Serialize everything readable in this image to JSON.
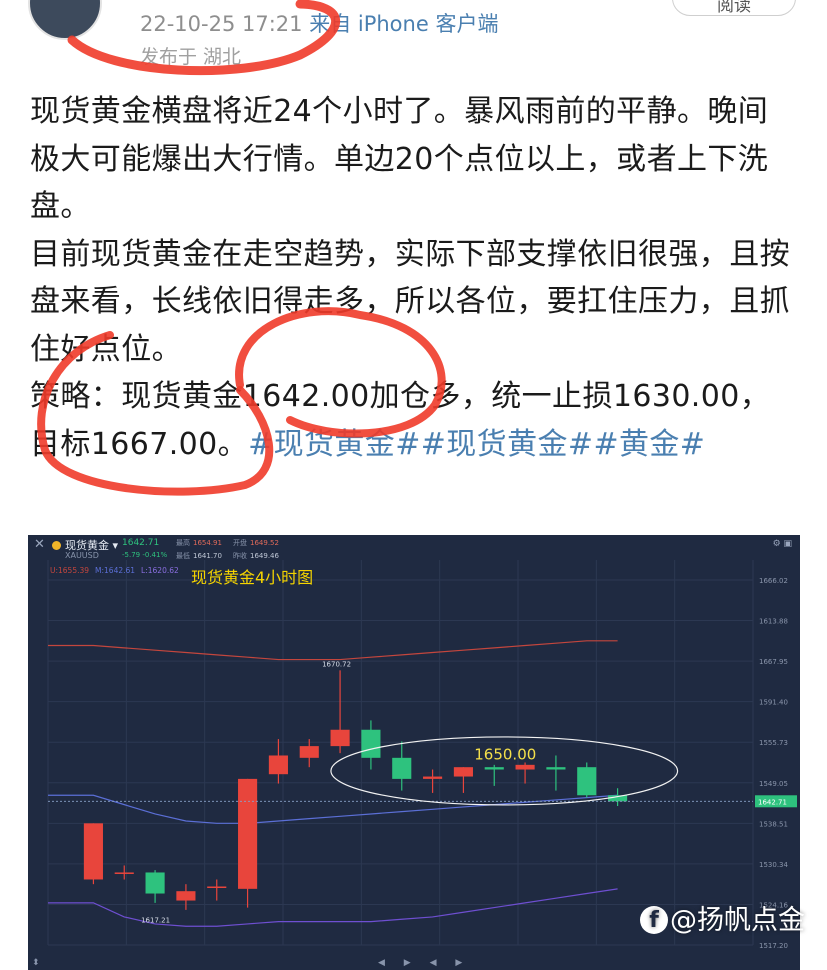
{
  "header": {
    "time": "22-10-25 17:21",
    "source": "来自 iPhone 客户端",
    "location": "发布于 湖北",
    "follow_label": "阅读"
  },
  "post": {
    "line1": "现货黄金横盘将近24个小时了。暴风雨前的平静。晚间极大可能爆出大行情。单边20个点位以上，或者上下洗盘。",
    "line2": "目前现货黄金在走空趋势，实际下部支撑依旧很强，且按盘来看，长线依旧得走多，所以各位，要扛住压力，且抓住好点位。",
    "line3_text": "策略：现货黄金1642.00加仓多，统一止损1630.00，目标1667.00。",
    "tags": [
      "#现货黄金#",
      "#现货黄金#",
      "#黄金#"
    ]
  },
  "chart_header": {
    "close": "✕",
    "name": "现货黄金 ▾",
    "symbol": "XAUUSD",
    "last": "1642.71",
    "change": "-5.79  -0.41%",
    "stats": [
      {
        "k": "最高",
        "v": "1654.91"
      },
      {
        "k": "开盘",
        "v": "1649.52"
      },
      {
        "k": "最低",
        "v": "1641.70"
      },
      {
        "k": "昨收",
        "v": "1649.46"
      }
    ],
    "bb": {
      "upper": "U:1655.39",
      "mid": "M:1642.61",
      "lower": "L:1620.62"
    },
    "title": "现货黄金4小时图",
    "footer": "◀ ▶ ◀ ▶"
  },
  "chart_data": {
    "type": "candlestick",
    "title": "现货黄金4小时图",
    "ylim": [
      1612,
      1690
    ],
    "y_ticks": [
      "1666.02",
      "1613.88",
      "1667.95",
      "1591.40",
      "1555.73",
      "1549.05",
      "1538.51",
      "1530.34",
      "1524.16",
      "1517.20"
    ],
    "last_price_label": "1642.71",
    "high_label": "1670.72",
    "low_label": "1617.21",
    "annotation": "1650.00",
    "candles": [
      {
        "o": 1626.0,
        "h": 1638.0,
        "l": 1625.0,
        "c": 1638.0
      },
      {
        "o": 1627.5,
        "h": 1629.0,
        "l": 1626.0,
        "c": 1627.5
      },
      {
        "o": 1627.5,
        "h": 1628.0,
        "l": 1621.0,
        "c": 1623.0
      },
      {
        "o": 1621.5,
        "h": 1625.0,
        "l": 1619.5,
        "c": 1623.5
      },
      {
        "o": 1624.5,
        "h": 1626.0,
        "l": 1621.5,
        "c": 1624.5
      },
      {
        "o": 1624.0,
        "h": 1647.5,
        "l": 1620.0,
        "c": 1647.5
      },
      {
        "o": 1648.5,
        "h": 1656.0,
        "l": 1646.5,
        "c": 1652.5
      },
      {
        "o": 1652.0,
        "h": 1656.0,
        "l": 1650.0,
        "c": 1654.5
      },
      {
        "o": 1654.5,
        "h": 1670.7,
        "l": 1653.0,
        "c": 1658.0
      },
      {
        "o": 1658.0,
        "h": 1660.0,
        "l": 1649.5,
        "c": 1652.0
      },
      {
        "o": 1652.0,
        "h": 1655.5,
        "l": 1645.0,
        "c": 1647.5
      },
      {
        "o": 1647.5,
        "h": 1649.5,
        "l": 1644.5,
        "c": 1648.0
      },
      {
        "o": 1648.0,
        "h": 1650.0,
        "l": 1644.5,
        "c": 1650.0
      },
      {
        "o": 1650.0,
        "h": 1650.5,
        "l": 1646.0,
        "c": 1649.5
      },
      {
        "o": 1649.5,
        "h": 1651.0,
        "l": 1646.5,
        "c": 1650.5
      },
      {
        "o": 1650.0,
        "h": 1652.5,
        "l": 1645.0,
        "c": 1649.5
      },
      {
        "o": 1650.0,
        "h": 1651.0,
        "l": 1643.5,
        "c": 1644.0
      },
      {
        "o": 1644.0,
        "h": 1645.5,
        "l": 1641.7,
        "c": 1642.7
      }
    ],
    "bollinger": {
      "upper": [
        1676,
        1675.5,
        1675,
        1674.5,
        1674,
        1673.5,
        1673,
        1673,
        1673,
        1673.5,
        1674,
        1674.5,
        1675,
        1675.5,
        1676,
        1676.5,
        1677,
        1677
      ],
      "middle": [
        1644,
        1642,
        1640,
        1638.5,
        1638,
        1638,
        1638.5,
        1639,
        1639.5,
        1640,
        1640.5,
        1641,
        1641.5,
        1642,
        1642.5,
        1643,
        1643.5,
        1644
      ],
      "lower": [
        1621,
        1618,
        1616.5,
        1616,
        1616,
        1616.5,
        1617,
        1617,
        1617,
        1617,
        1617.5,
        1618,
        1619,
        1620,
        1621,
        1622,
        1623,
        1624
      ]
    },
    "colors": {
      "up": "#e8453c",
      "down": "#2ec27e",
      "upper": "#c4463d",
      "middle": "#5b6fd6",
      "lower": "#6e4fd1"
    }
  },
  "watermark": {
    "fb": "f",
    "text": "@扬帆点金"
  }
}
